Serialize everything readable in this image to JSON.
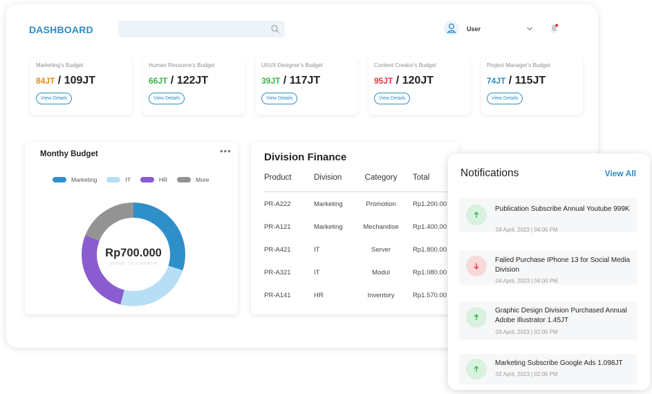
{
  "header": {
    "title": "DASHBOARD",
    "user_name": "User"
  },
  "budgets": [
    {
      "label": "Marketing's Budget",
      "used": "84JT",
      "total": "109JT",
      "color": "#e08a1e",
      "button": "View Details"
    },
    {
      "label": "Human Resource's Budget",
      "used": "66JT",
      "total": "122JT",
      "color": "#3bb34a",
      "button": "View Details"
    },
    {
      "label": "UI/UX Designer's Budget",
      "used": "39JT",
      "total": "117JT",
      "color": "#3bb34a",
      "button": "View Details"
    },
    {
      "label": "Content Creator's Budget",
      "used": "95JT",
      "total": "120JT",
      "color": "#e03a3a",
      "button": "View Details"
    },
    {
      "label": "Project Manager's Budget",
      "used": "74JT",
      "total": "115JT",
      "color": "#2a8cc4",
      "button": "View Details"
    }
  ],
  "monthly_budget": {
    "title": "Monthy Budget",
    "center_value": "Rp700.000",
    "center_sub": "SPEND THIS MONTH",
    "legend": [
      {
        "label": "Marketing",
        "color": "#2f8fc9"
      },
      {
        "label": "IT",
        "color": "#b6dff5"
      },
      {
        "label": "HR",
        "color": "#8a5cd0"
      },
      {
        "label": "More",
        "color": "#939393"
      }
    ],
    "segments": [
      {
        "label": "Marketing",
        "fraction": 0.3,
        "color": "#2f8fc9"
      },
      {
        "label": "IT",
        "fraction": 0.24,
        "color": "#b6dff5"
      },
      {
        "label": "HR",
        "fraction": 0.27,
        "color": "#8a5cd0"
      },
      {
        "label": "More",
        "fraction": 0.19,
        "color": "#939393"
      }
    ]
  },
  "division_finance": {
    "title": "Division Finance",
    "columns": [
      "Product",
      "Division",
      "Category",
      "Total"
    ],
    "rows": [
      [
        "PR-A222",
        "Marketing",
        "Promotion",
        "Rp1.200.00"
      ],
      [
        "PR-A121",
        "Marketing",
        "Mechandise",
        "Rp1.400.00"
      ],
      [
        "PR-A421",
        "IT",
        "Server",
        "Rp1.800.00"
      ],
      [
        "PR-A321",
        "IT",
        "Modul",
        "Rp1.080.00"
      ],
      [
        "PR-A141",
        "HR",
        "Inventory",
        "Rp1.570.00"
      ]
    ]
  },
  "notifications": {
    "title": "Notifications",
    "view_all": "View All",
    "items": [
      {
        "text": "Publication Subscribe Annual Youtube 999K",
        "date": "04 April, 2023 | 04:00 PM",
        "direction": "up"
      },
      {
        "text": "Failed Purchase IPhone 13 for Social Media Division",
        "date": "04 April, 2023 | 04:00 PM",
        "direction": "down"
      },
      {
        "text": "Graphic Design Division Purchased Annual Adobe Illustrator 1.45JT",
        "date": "03 April, 2023 | 02:00 PM",
        "direction": "up"
      },
      {
        "text": "Marketing Subscribe Google Ads 1.098JT",
        "date": "02 April, 2023 | 02:00 PM",
        "direction": "up"
      }
    ]
  }
}
